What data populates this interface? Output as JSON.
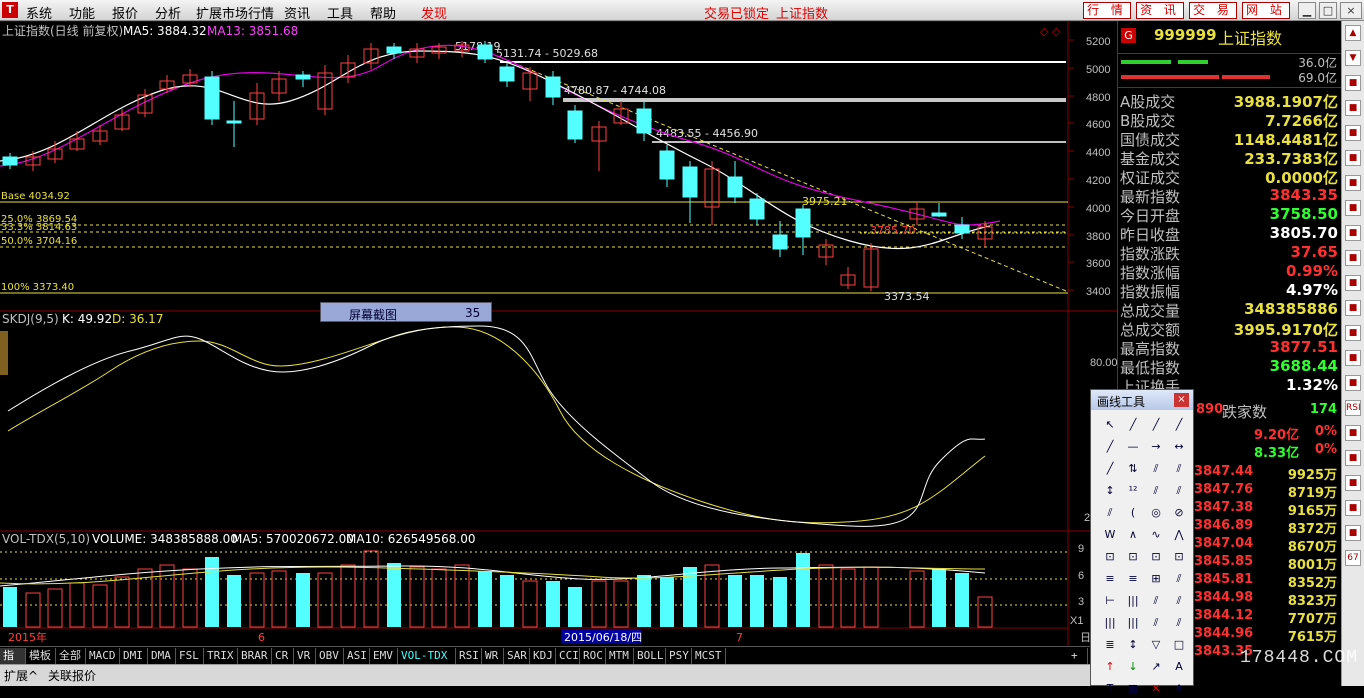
{
  "menubar": {
    "logo": "T",
    "items": [
      "系统",
      "功能",
      "报价",
      "分析",
      "扩展市场行情",
      "资讯",
      "工具",
      "帮助"
    ],
    "discover": "发现",
    "lock_status": "交易已锁定",
    "index_name": "上证指数",
    "top_buttons": [
      "行 情",
      "资 讯",
      "交 易",
      "网 站"
    ]
  },
  "chart": {
    "title": "上证指数(日线 前复权)",
    "ma5_label": "MA5: 3884.32",
    "ma13_label": "MA13: 3851.68",
    "y_ticks": [
      "5200",
      "5000",
      "4800",
      "4600",
      "4400",
      "4200",
      "4000",
      "3800",
      "3600",
      "3400"
    ],
    "fib": {
      "base": "Base 4034.92",
      "l25": "25.0% 3869.54",
      "l33": "33.3% 3814.63",
      "l50": "50.0% 3704.16",
      "l100": "100% 3373.40"
    },
    "annotations": {
      "a1": "5178.19",
      "a2": "5131.74 - 5029.68",
      "a3": "4780.87 - 4744.08",
      "a4": "4483.55 - 4456.90",
      "a5": "3975.21",
      "a6": "3785.70",
      "a7": "3373.54"
    },
    "kdj_label": "SKDJ(9,5)",
    "kdj_k": "K: 49.92",
    "kdj_d": "D: 36.17",
    "kdj_tick": "80.00",
    "kdj_tick2": "2",
    "vol_label": "VOL-TDX(5,10)",
    "vol_val": "VOLUME: 348385888.00",
    "vol_ma5": "MA5: 570020672.00",
    "vol_ma10": "MA10: 626549568.00",
    "vol_ticks": [
      "9",
      "6",
      "3"
    ],
    "vol_unit": "X1",
    "date_axis": {
      "year": "2015年",
      "m6": "6",
      "sel": "2015/06/18/四",
      "m7": "7",
      "end": "日"
    },
    "screenshot_tip": {
      "label": "屏幕截图",
      "value": "35"
    }
  },
  "right_panel": {
    "ticker_icon": "G",
    "code": "999999",
    "name": "上证指数",
    "bar1": "36.0亿",
    "bar2": "69.0亿",
    "rows": [
      {
        "l": "A股成交",
        "v": "3988.1907亿",
        "c": "#e8e040"
      },
      {
        "l": "B股成交",
        "v": "7.7266亿",
        "c": "#e8e040"
      },
      {
        "l": "国债成交",
        "v": "1148.4481亿",
        "c": "#e8e040"
      },
      {
        "l": "基金成交",
        "v": "233.7383亿",
        "c": "#e8e040"
      },
      {
        "l": "权证成交",
        "v": "0.0000亿",
        "c": "#e8e040"
      },
      {
        "l": "最新指数",
        "v": "3843.35",
        "c": "#ff3030"
      },
      {
        "l": "今日开盘",
        "v": "3758.50",
        "c": "#30ff30"
      },
      {
        "l": "昨日收盘",
        "v": "3805.70",
        "c": "#ffffff"
      },
      {
        "l": "指数涨跌",
        "v": "37.65",
        "c": "#ff3030"
      },
      {
        "l": "指数涨幅",
        "v": "0.99%",
        "c": "#ff3030"
      },
      {
        "l": "指数振幅",
        "v": "4.97%",
        "c": "#ffffff"
      },
      {
        "l": "总成交量",
        "v": "348385886",
        "c": "#e8e040"
      },
      {
        "l": "总成交额",
        "v": "3995.9170亿",
        "c": "#e8e040"
      },
      {
        "l": "最高指数",
        "v": "3877.51",
        "c": "#ff3030"
      },
      {
        "l": "最低指数",
        "v": "3688.44",
        "c": "#30ff30"
      },
      {
        "l": "上证换手",
        "v": "1.32%",
        "c": "#ffffff"
      }
    ],
    "fall_count_prefix": "890",
    "fall_label": "跌家数",
    "fall_count": "174",
    "amt1": "9.20亿",
    "pct1": "0%",
    "amt2": "8.33亿",
    "pct2": "0%",
    "ticks": [
      {
        "p": "3847.44",
        "v": "9925万"
      },
      {
        "p": "3847.76",
        "v": "8719万"
      },
      {
        "p": "3847.38",
        "v": "9165万"
      },
      {
        "p": "3846.89",
        "v": "8372万"
      },
      {
        "p": "3847.04",
        "v": "8670万"
      },
      {
        "p": "3845.85",
        "v": "8001万"
      },
      {
        "p": "3845.81",
        "v": "8352万"
      },
      {
        "p": "3844.98",
        "v": "8323万"
      },
      {
        "p": "3844.12",
        "v": "7707万"
      },
      {
        "p": "3844.96",
        "v": "7615万"
      },
      {
        "p": "3843.35",
        "v": ""
      }
    ]
  },
  "tabs": [
    "指标",
    "模板",
    "全部",
    "MACD",
    "DMI",
    "DMA",
    "FSL",
    "TRIX",
    "BRAR",
    "CR",
    "VR",
    "OBV",
    "ASI",
    "EMV",
    "VOL-TDX",
    "RSI",
    "WR",
    "SAR",
    "KDJ",
    "CCI",
    "ROC",
    "MTM",
    "BOLL",
    "PSY",
    "MCST"
  ],
  "tab_plus": "+",
  "bottom_tabs": [
    "扩展^",
    "关联报价"
  ],
  "draw_tool": {
    "title": "画线工具",
    "close": "×"
  },
  "watermark": "178448.COM",
  "scroll_icons": [
    "▲",
    "▼",
    "■",
    "■",
    "■",
    "■",
    "■",
    "■",
    "■",
    "■",
    "■",
    "■",
    "■",
    "■",
    "■",
    "RSI",
    "■",
    "■",
    "■",
    "■",
    "■",
    "67"
  ]
}
